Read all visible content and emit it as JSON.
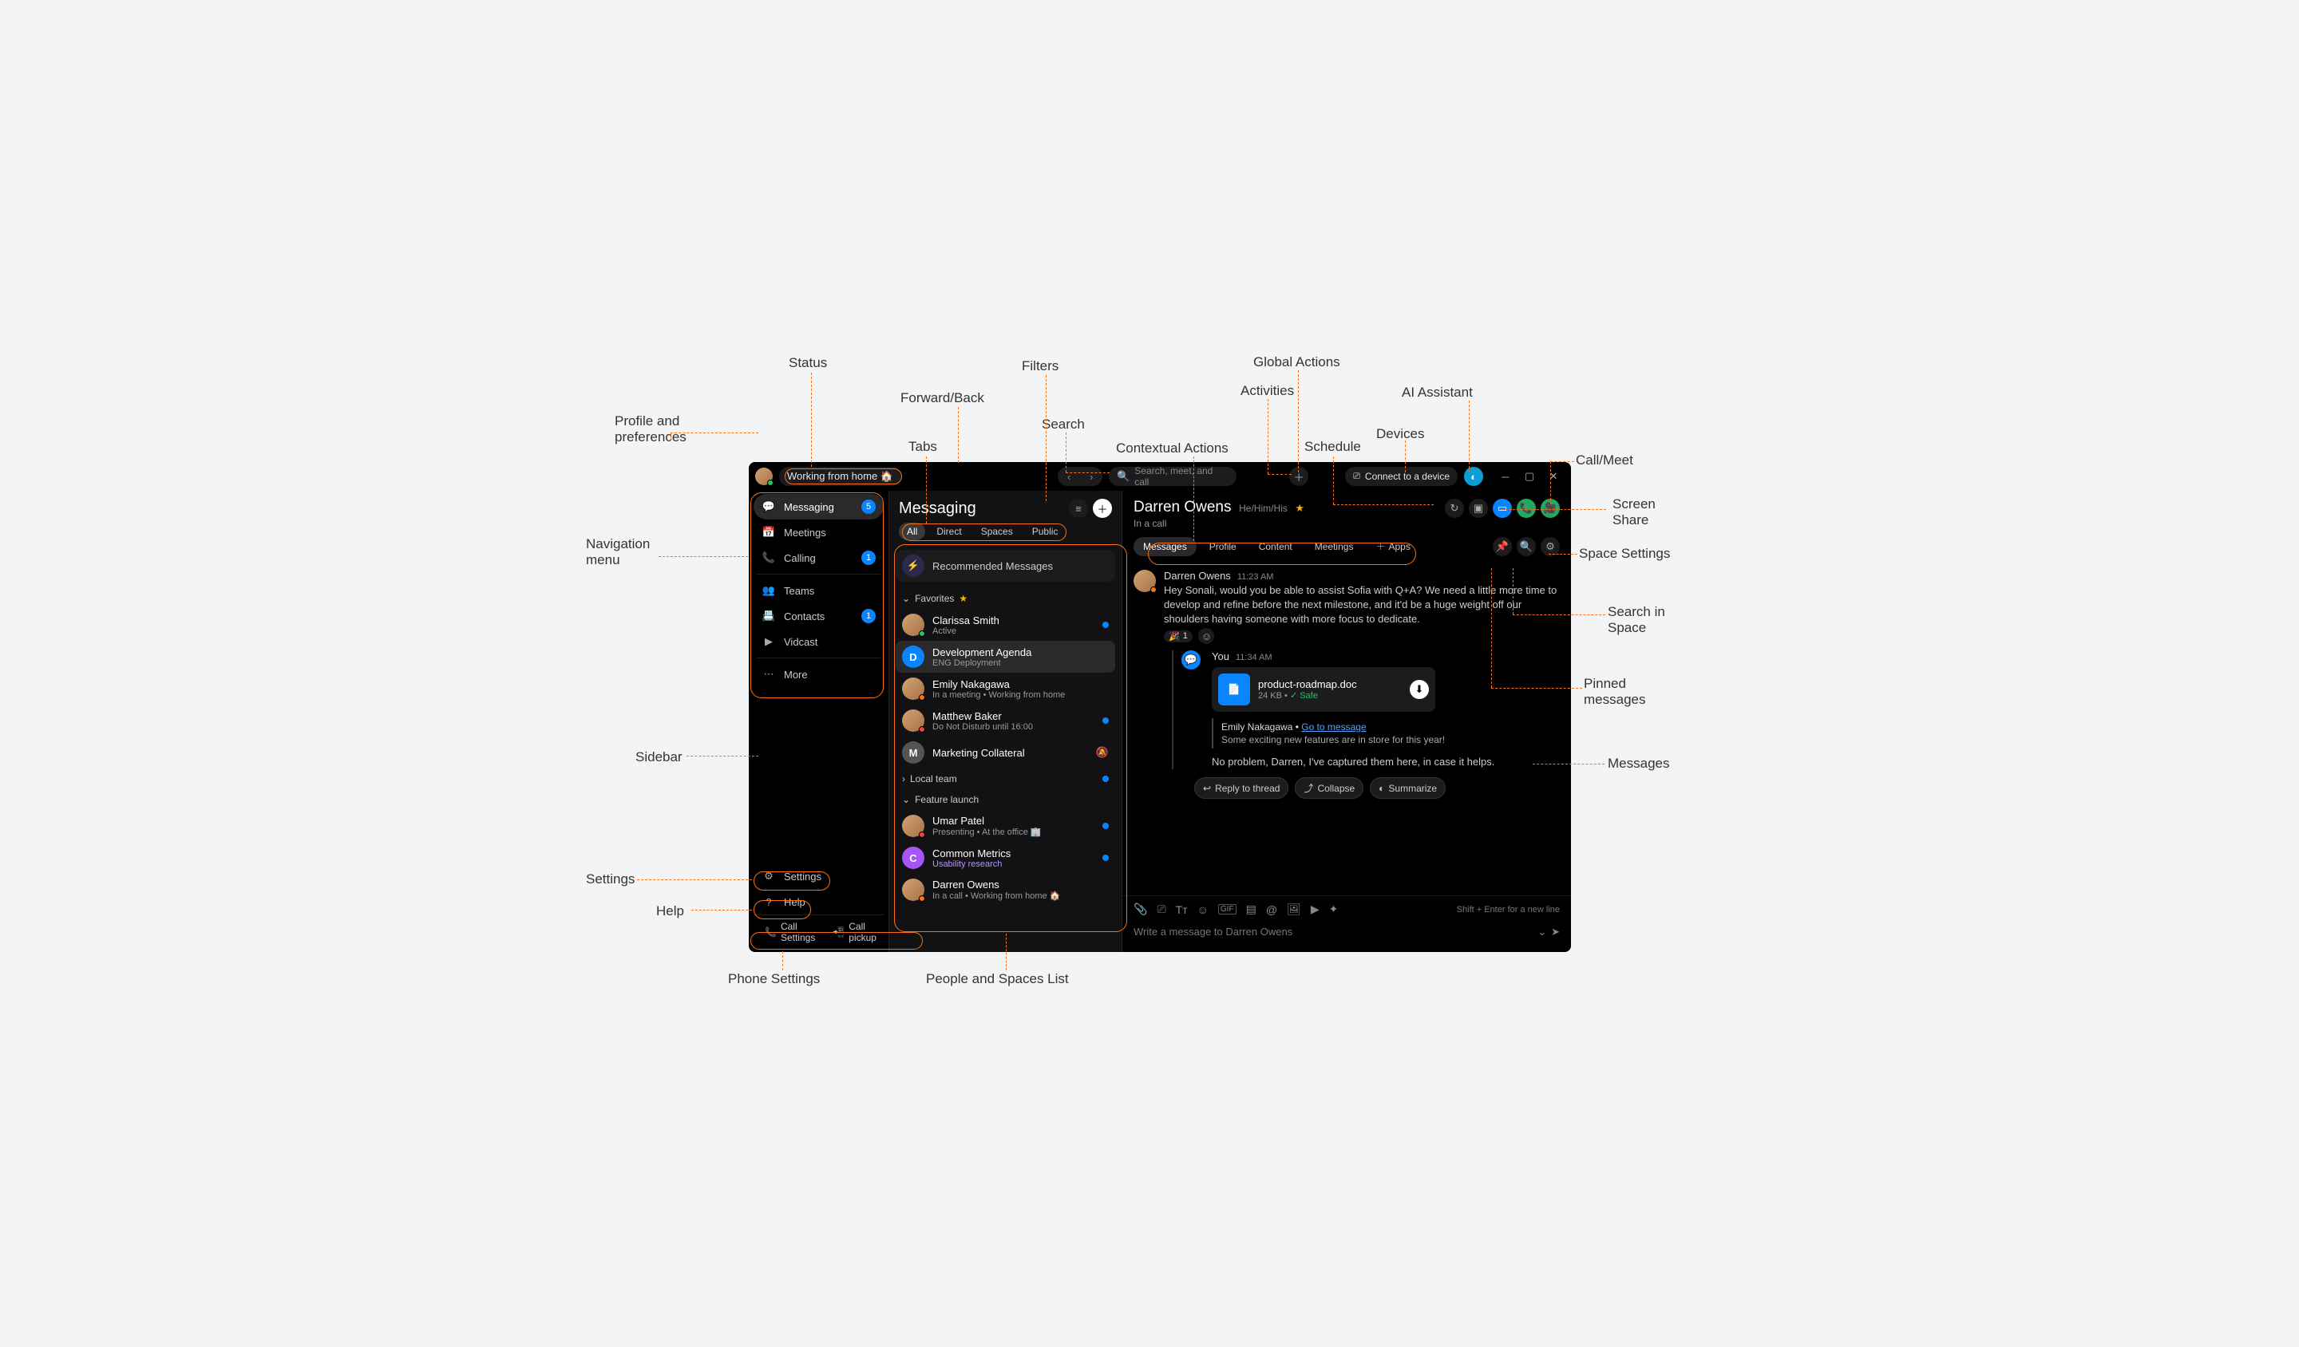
{
  "labels": {
    "profile": "Profile and preferences",
    "status": "Status",
    "tabs": "Tabs",
    "fwdback": "Forward/Back",
    "filters": "Filters",
    "search": "Search",
    "contextual": "Contextual Actions",
    "activities": "Activities",
    "global": "Global Actions",
    "schedule": "Schedule",
    "devices": "Devices",
    "ai": "AI Assistant",
    "callmeet": "Call/Meet",
    "screenshare": "Screen Share",
    "spacesettings": "Space Settings",
    "searchspace": "Search in Space",
    "pinnedmsg": "Pinned messages",
    "messages": "Messages",
    "sidebar": "Sidebar",
    "navmenu": "Navigation menu",
    "settings": "Settings",
    "help": "Help",
    "phonesettings": "Phone Settings",
    "peoplespaces": "People and Spaces List"
  },
  "topbar": {
    "status": "Working from home 🏠",
    "search_placeholder": "Search, meet, and call",
    "devices": "Connect to a device"
  },
  "nav": {
    "items": [
      {
        "icon": "chat",
        "label": "Messaging",
        "badge": "5",
        "active": true
      },
      {
        "icon": "cal",
        "label": "Meetings"
      },
      {
        "icon": "phone",
        "label": "Calling",
        "badge": "1"
      },
      {
        "sep": true
      },
      {
        "icon": "team",
        "label": "Teams"
      },
      {
        "icon": "contacts",
        "label": "Contacts",
        "badge": "1"
      },
      {
        "icon": "vidcast",
        "label": "Vidcast"
      },
      {
        "sep": true
      },
      {
        "icon": "more",
        "label": "More"
      }
    ],
    "settings": "Settings",
    "help": "Help",
    "callsettings": "Call Settings",
    "callpickup": "Call pickup"
  },
  "list": {
    "title": "Messaging",
    "tabs": [
      "All",
      "Direct",
      "Spaces",
      "Public"
    ],
    "active_tab": 0,
    "recommended": "Recommended Messages",
    "sections": {
      "favorites": "Favorites",
      "localteam": "Local team",
      "featurelaunch": "Feature launch"
    },
    "items": [
      {
        "avatar": "cs",
        "presence": "green",
        "t1": "Clarissa Smith",
        "t2": "Active",
        "dot": true
      },
      {
        "sq": "D",
        "sqc": "#0a84ff",
        "t1": "Development Agenda",
        "t2": "ENG Deployment",
        "sel": true
      },
      {
        "avatar": "en",
        "presence": "orange",
        "t1": "Emily Nakagawa",
        "t2": "In a meeting  •  Working from home"
      },
      {
        "avatar": "mb",
        "presence": "red",
        "t1": "Matthew Baker",
        "t2": "Do Not Disturb until 16:00",
        "dot": true
      },
      {
        "sq": "M",
        "sqc": "#555",
        "t1": "Marketing Collateral",
        "mute": true
      },
      {
        "avatar": "up",
        "presence": "red",
        "t1": "Umar Patel",
        "t2": "Presenting  •  At the office 🏢",
        "dot": true
      },
      {
        "sq": "C",
        "sqc": "#a855f7",
        "t1": "Common Metrics",
        "t2": "Usability research",
        "t2c": "#b794f6",
        "dot": true
      },
      {
        "avatar": "do",
        "presence": "orange",
        "t1": "Darren Owens",
        "t2": "In a call  •  Working from home 🏠"
      }
    ]
  },
  "conv": {
    "name": "Darren Owens",
    "pronouns": "He/Him/His",
    "status": "In a call",
    "tabs": [
      "Messages",
      "Profile",
      "Content",
      "Meetings"
    ],
    "apps": "Apps",
    "msg1": {
      "author": "Darren Owens",
      "time": "11:23 AM",
      "text": "Hey Sonali, would you be able to assist Sofia with Q+A? We need a little more time to develop and refine before the next milestone, and it'd be a huge weight off our shoulders having someone with more focus to dedicate.",
      "react": "🎉",
      "reactn": "1"
    },
    "msg2": {
      "author": "You",
      "time": "11:34 AM",
      "file": {
        "name": "product-roadmap.doc",
        "size": "24 KB",
        "safe": "Safe"
      },
      "quote": {
        "author": "Emily Nakagawa",
        "link": "Go to message",
        "text": "Some exciting new features are in store for this year!"
      },
      "text": "No problem, Darren, I've captured them here, in case it helps."
    },
    "buttons": {
      "reply": "Reply to thread",
      "collapse": "Collapse",
      "summarize": "Summarize"
    },
    "compose_hint": "Shift + Enter for a new line",
    "compose_placeholder": "Write a message to Darren Owens"
  }
}
